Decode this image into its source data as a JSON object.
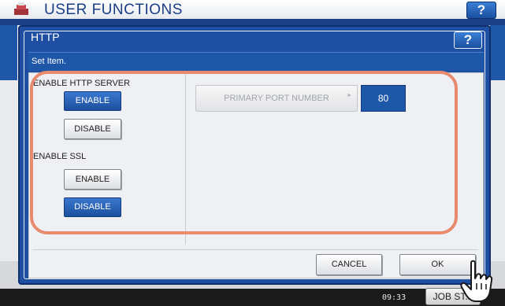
{
  "background": {
    "title": "USER FUNCTIONS",
    "help_label": "?",
    "clock": "09:33",
    "job_status_label": "JOB ST..."
  },
  "dialog": {
    "title": "HTTP",
    "help_label": "?",
    "subtitle": "Set Item.",
    "http_server": {
      "label": "ENABLE HTTP SERVER",
      "enable_label": "ENABLE",
      "disable_label": "DISABLE",
      "selected": "ENABLE"
    },
    "ssl": {
      "label": "ENABLE SSL",
      "enable_label": "ENABLE",
      "disable_label": "DISABLE",
      "selected": "DISABLE"
    },
    "port": {
      "label": "PRIMARY PORT NUMBER",
      "value": "80"
    },
    "cancel_label": "CANCEL",
    "ok_label": "OK"
  },
  "colors": {
    "accent_blue": "#1e56a8",
    "highlight": "#e88a6e"
  },
  "icons": [
    "copier-logo-icon",
    "pointing-hand-icon"
  ]
}
